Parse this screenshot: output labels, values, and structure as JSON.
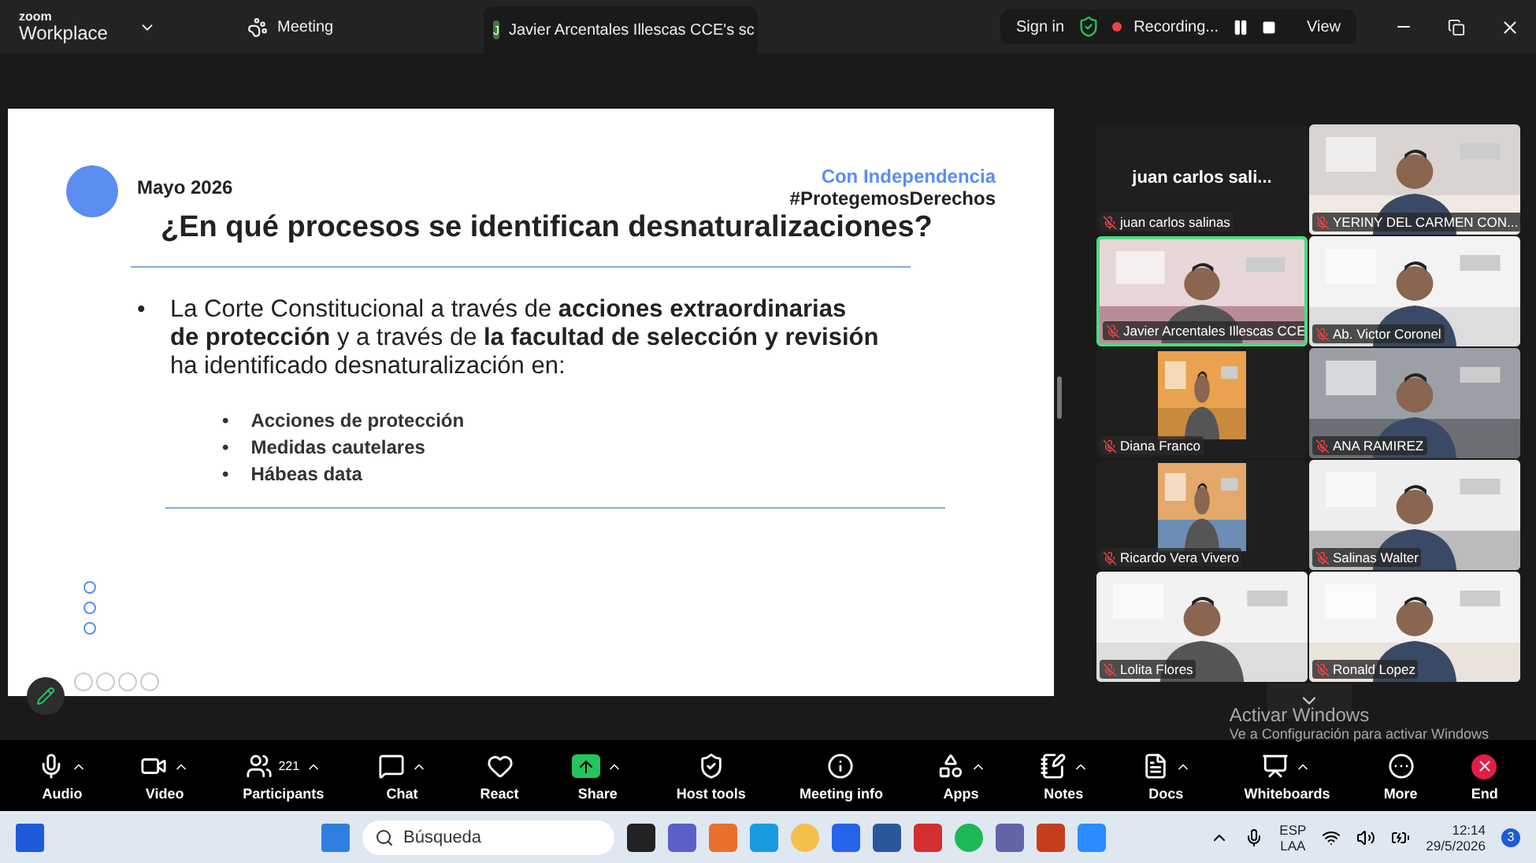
{
  "top_bar": {
    "logo_small": "zoom",
    "logo": "Workplace",
    "menu": "Meeting",
    "tab": {
      "avatar": "J",
      "title": "Javier Arcentales Illescas CCE's sc"
    },
    "sign_in": "Sign in",
    "recording": "Recording...",
    "view": "View"
  },
  "slide": {
    "date": "Mayo 2026",
    "tagline": "Con Independencia",
    "hashtag": "#ProtegemosDerechos",
    "title": "¿En qué procesos se identifican desnaturalizaciones?",
    "paragraph_bullet": "•",
    "paragraph": "La Corte Constitucional a través de **acciones extraordinarias de protección** y a través de **la facultad de selección y revisión** ha identificado desnaturalización en:",
    "items": [
      {
        "bullet": "•",
        "text": "Acciones de protección"
      },
      {
        "bullet": "•",
        "text": "Medidas cautelares"
      },
      {
        "bullet": "•",
        "text": "Hábeas data"
      }
    ]
  },
  "gallery": {
    "tiles": [
      {
        "kind": "text",
        "display": "juan  carlos sali...",
        "name": "juan  carlos salinas",
        "selected": false
      },
      {
        "kind": "video",
        "name": "YERINY DEL CARMEN CON...",
        "selected": false
      },
      {
        "kind": "video",
        "name": "Javier Arcentales Illescas CCE",
        "selected": true
      },
      {
        "kind": "video",
        "name": "Ab. Victor Coronel",
        "selected": false
      },
      {
        "kind": "portrait",
        "name": "Diana Franco",
        "selected": false
      },
      {
        "kind": "video",
        "name": "ANA RAMIREZ",
        "selected": false
      },
      {
        "kind": "portrait",
        "name": "Ricardo Vera Vivero",
        "selected": false
      },
      {
        "kind": "video",
        "name": "Salinas Walter",
        "selected": false
      },
      {
        "kind": "video",
        "name": "Lolita Flores",
        "selected": false
      },
      {
        "kind": "video",
        "name": "Ronald Lopez",
        "selected": false
      }
    ]
  },
  "toolbar": {
    "items": [
      {
        "kind": "mic",
        "label": "Audio",
        "caret": true
      },
      {
        "kind": "video",
        "label": "Video",
        "caret": true
      },
      {
        "kind": "users",
        "label": "Participants",
        "caret": true,
        "count": "221"
      },
      {
        "kind": "chat",
        "label": "Chat",
        "caret": true
      },
      {
        "kind": "heart",
        "label": "React",
        "caret": false
      },
      {
        "kind": "share",
        "label": "Share",
        "caret": true
      },
      {
        "kind": "shield",
        "label": "Host tools",
        "caret": false
      },
      {
        "kind": "info",
        "label": "Meeting info",
        "caret": false
      },
      {
        "kind": "apps",
        "label": "Apps",
        "caret": true
      },
      {
        "kind": "notes",
        "label": "Notes",
        "caret": true
      },
      {
        "kind": "docs",
        "label": "Docs",
        "caret": true
      },
      {
        "kind": "board",
        "label": "Whiteboards",
        "caret": true
      },
      {
        "kind": "more",
        "label": "More",
        "caret": false
      },
      {
        "kind": "end",
        "label": "End",
        "caret": false
      }
    ]
  },
  "activation": {
    "title": "Activar Windows",
    "subtitle": "Ve a Configuración para activar Windows"
  },
  "taskbar": {
    "search": "Búsqueda",
    "language": "ESP",
    "layout": "LAA",
    "time": "12:14",
    "date": "29/5/2026",
    "notifications": "3"
  }
}
